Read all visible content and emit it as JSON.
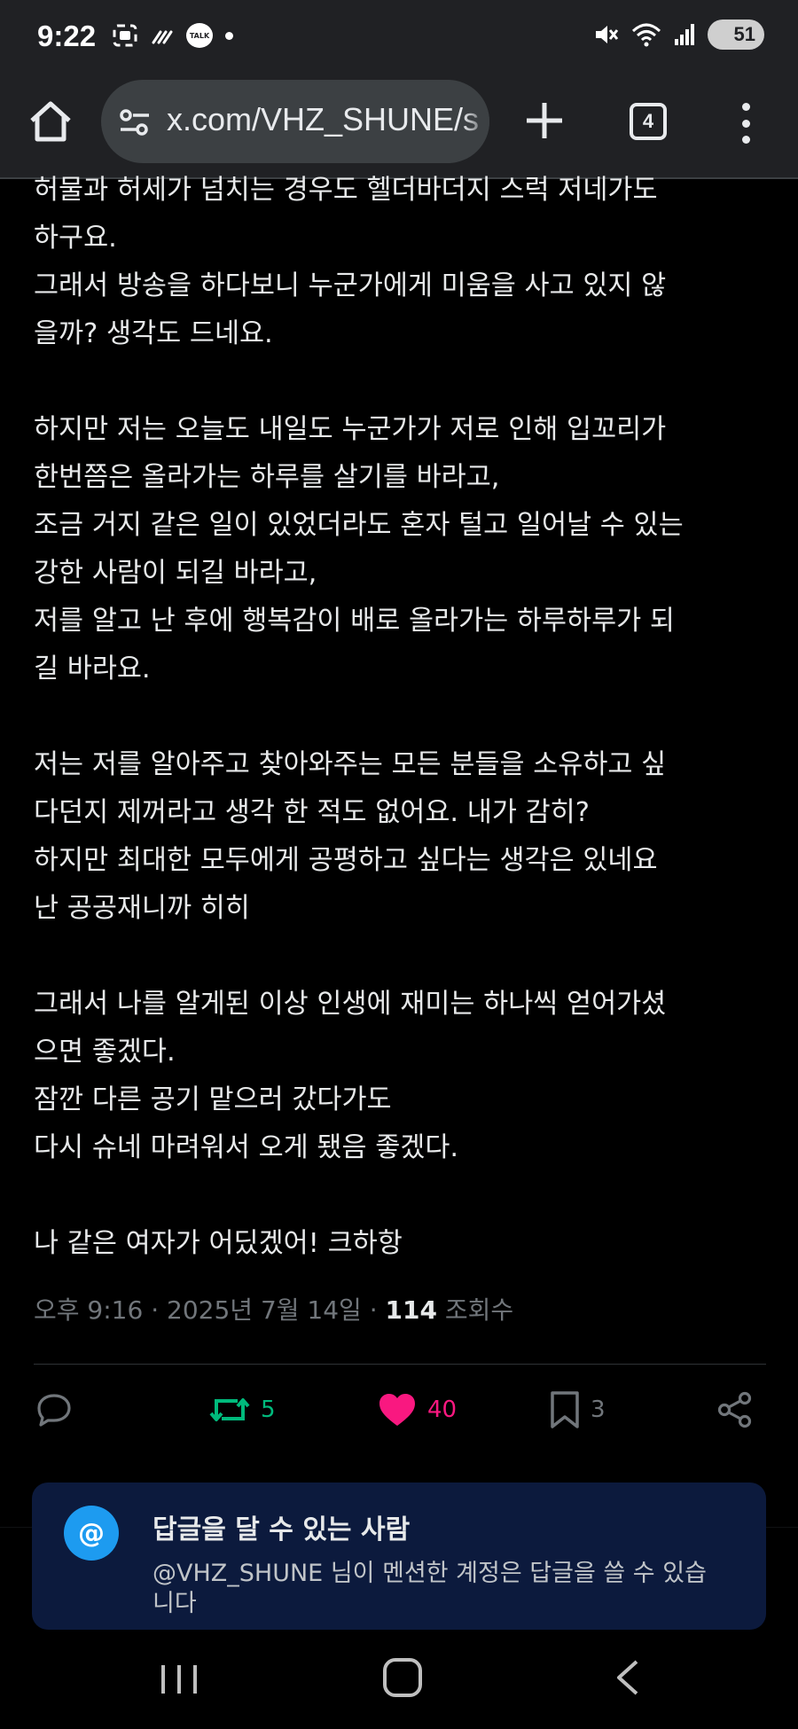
{
  "status_bar": {
    "time": "9:22",
    "talk_badge": "TALK",
    "battery": "51"
  },
  "browser": {
    "url": "x.com/VHZ_SHUNE/s",
    "tab_count": "4"
  },
  "post": {
    "lines": [
      "허물과 허세가 넘치는 경우도 헬더바더지 스럭 저네가도",
      "하구요.",
      "그래서 방송을 하다보니 누군가에게 미움을 사고 있지 않",
      "을까? 생각도 드네요.",
      "",
      "하지만 저는 오늘도 내일도 누군가가 저로 인해 입꼬리가",
      "한번쯤은 올라가는 하루를 살기를 바라고,",
      "조금 거지 같은 일이 있었더라도 혼자 털고 일어날 수 있는",
      "강한 사람이 되길 바라고,",
      "저를 알고 난 후에 행복감이 배로 올라가는 하루하루가 되",
      "길 바라요.",
      "",
      "저는 저를 알아주고 찾아와주는 모든 분들을 소유하고 싶",
      "다던지 제꺼라고 생각 한 적도 없어요. 내가 감히?",
      "하지만 최대한 모두에게 공평하고 싶다는 생각은 있네요",
      "난 공공재니까  히히",
      "",
      "그래서 나를 알게된 이상 인생에 재미는 하나씩 얻어가셨",
      "으면 좋겠다.",
      "잠깐 다른 공기 맡으러 갔다가도",
      "다시 슈네 마려워서 오게 됐음 좋겠다.",
      "",
      "나 같은 여자가 어딨겠어! 크하항"
    ],
    "time": "오후 9:16",
    "date": "2025년 7월 14일",
    "views_count": "114",
    "views_label": "조회수"
  },
  "actions": {
    "reposts": "5",
    "likes": "40",
    "bookmarks": "3"
  },
  "reply_restriction": {
    "icon": "@",
    "title": "답글을 달 수 있는 사람",
    "description_line1": "@VHZ_SHUNE 님이 멘션한 계정은 답글을 쓸 수 있습",
    "description_line2": "니다"
  },
  "colors": {
    "background": "#000000",
    "text": "#e7e9ea",
    "muted": "#71767b",
    "repost": "#00ba7c",
    "like": "#f91880",
    "accent": "#1d9bf0",
    "card": "#0c1a3d"
  },
  "icons": {
    "reply": "reply-icon",
    "repost": "repost-icon",
    "like": "heart-icon",
    "bookmark": "bookmark-icon",
    "share": "share-icon"
  }
}
